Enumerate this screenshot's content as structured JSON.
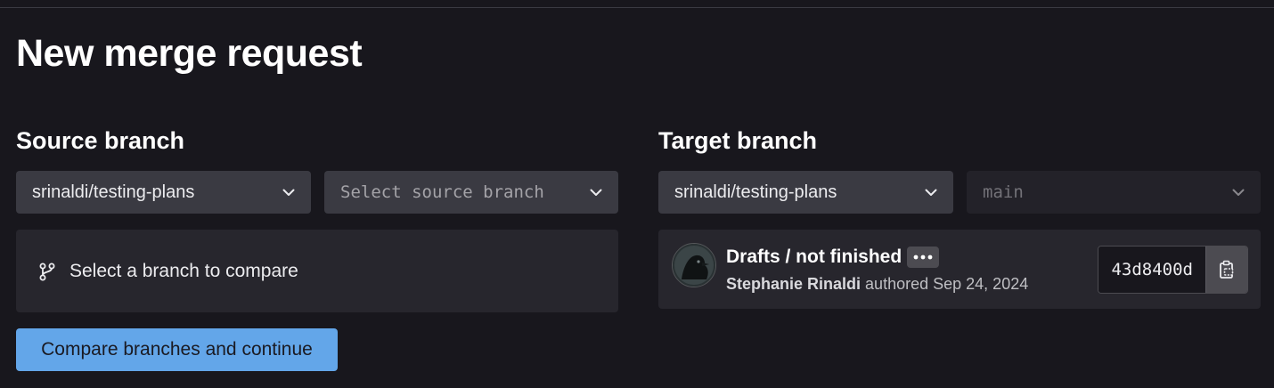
{
  "page": {
    "title": "New merge request"
  },
  "source": {
    "heading": "Source branch",
    "project_value": "srinaldi/testing-plans",
    "branch_placeholder": "Select source branch",
    "compare_message": "Select a branch to compare",
    "compare_button": "Compare branches and continue"
  },
  "target": {
    "heading": "Target branch",
    "project_value": "srinaldi/testing-plans",
    "branch_value": "main",
    "commit": {
      "title": "Drafts / not finished",
      "author": "Stephanie Rinaldi",
      "action": "authored",
      "date": "Sep 24, 2024",
      "sha": "43d8400d"
    }
  },
  "icons": {
    "chevron": "chevron-down-icon",
    "branch": "git-branch-icon",
    "ellipsis": "ellipsis-icon",
    "copy": "clipboard-copy-icon"
  },
  "colors": {
    "background": "#18171d",
    "dropdown": "#3a3a42",
    "panel": "#27262d",
    "primary_button": "#63a6e9"
  }
}
